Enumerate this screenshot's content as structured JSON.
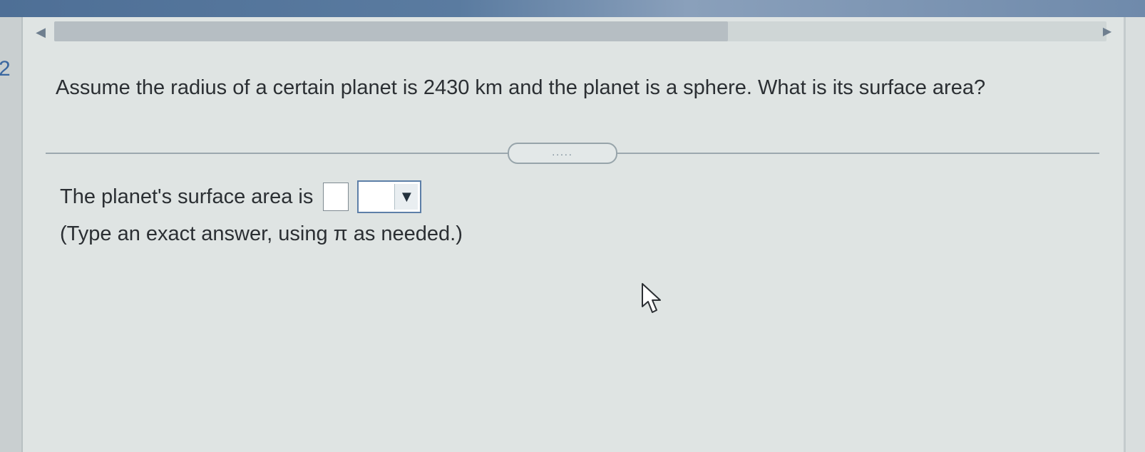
{
  "step": {
    "number": "2"
  },
  "navigation": {
    "left_icon": "caret-left-icon",
    "right_icon": "caret-right-icon"
  },
  "question": {
    "text": "Assume the radius of a certain planet is 2430 km and the planet is a sphere. What is its surface area?"
  },
  "expand_button": {
    "label": "....."
  },
  "answer": {
    "label": "The planet's surface area is",
    "input_value": "",
    "unit_selected": "",
    "hint": "(Type an exact answer, using π as needed.)"
  },
  "colors": {
    "accent": "#3a67a0",
    "dropdown_border": "#5d7fa8",
    "text": "#2b2f33",
    "panel_bg": "#dfe4e3"
  }
}
